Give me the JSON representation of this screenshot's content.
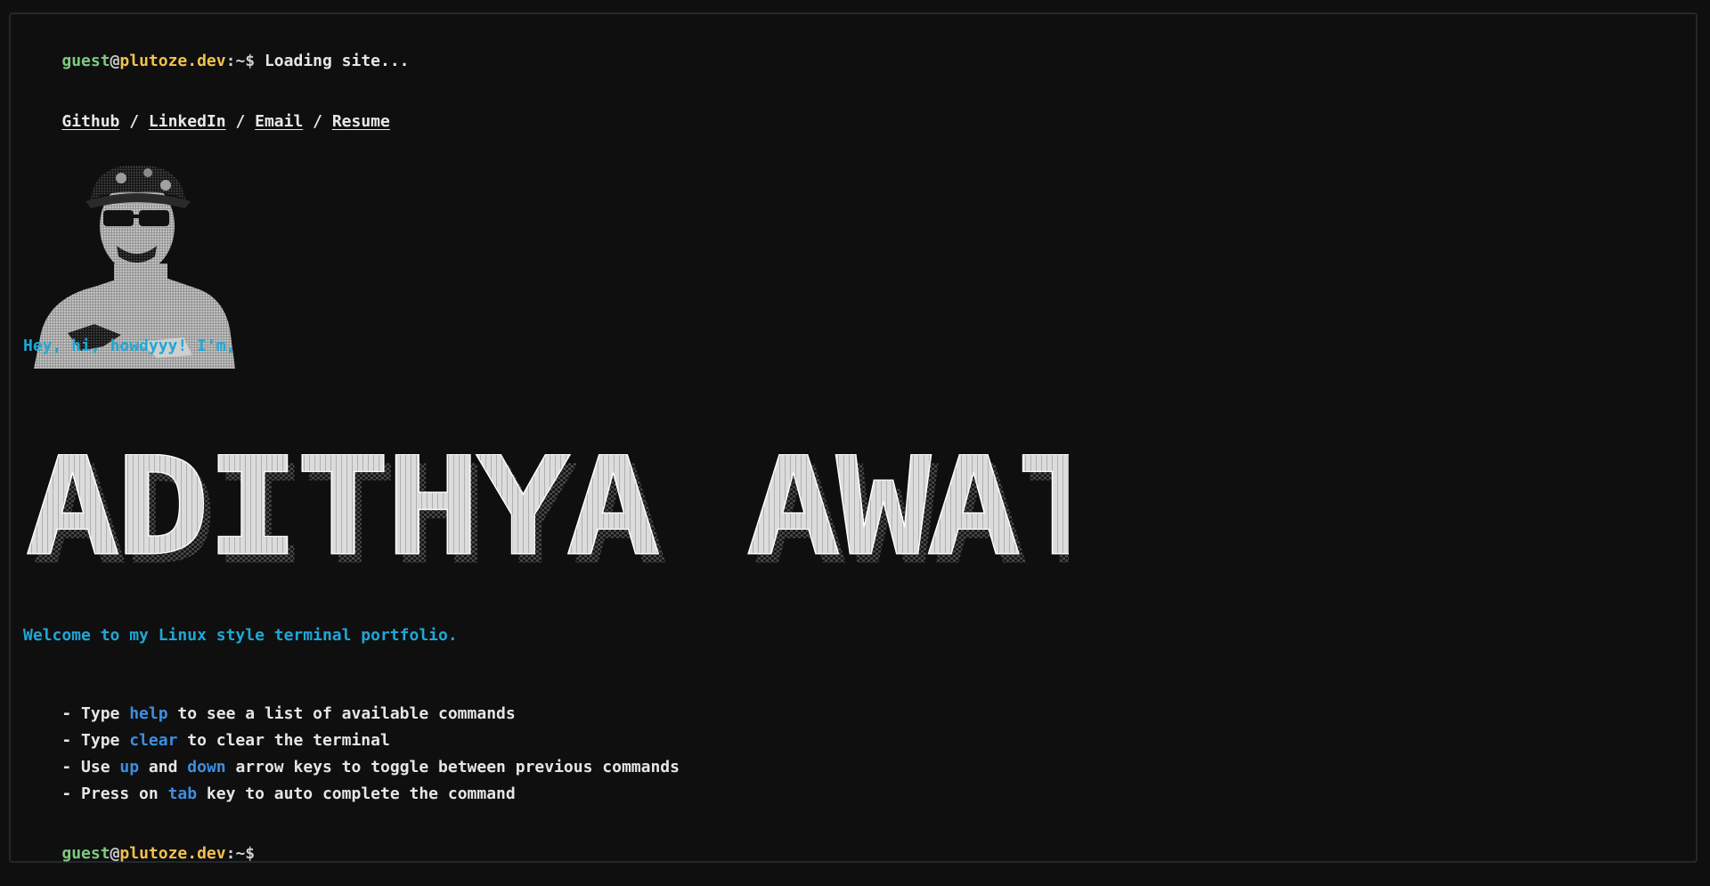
{
  "prompt": {
    "user": "guest",
    "at": "@",
    "host": "plutoze.dev",
    "path": ":~$"
  },
  "first_command": "Loading site...",
  "links": {
    "github": "Github",
    "linkedin": "LinkedIn",
    "email": "Email",
    "resume": "Resume",
    "separator": " / "
  },
  "greeting": "Hey, hi, howdyyy! I'm,",
  "banner_name": "ADITHYA AWATI",
  "welcome": "Welcome to my Linux style terminal portfolio.",
  "instructions": [
    {
      "pre": "- Type ",
      "key": "help",
      "post": " to see a list of available commands"
    },
    {
      "pre": "- Type ",
      "key": "clear",
      "post": " to clear the terminal"
    },
    {
      "pre": "- Use ",
      "key": "up",
      "mid": " and ",
      "key2": "down",
      "post": " arrow keys to toggle between previous commands"
    },
    {
      "pre": "- Press on ",
      "key": "tab",
      "post": " key to auto complete the command"
    }
  ],
  "colors": {
    "background": "#0f0f10",
    "user": "#7fc97f",
    "host": "#f2c14e",
    "accent": "#1ea7d6",
    "keyword": "#3d8fe0"
  }
}
